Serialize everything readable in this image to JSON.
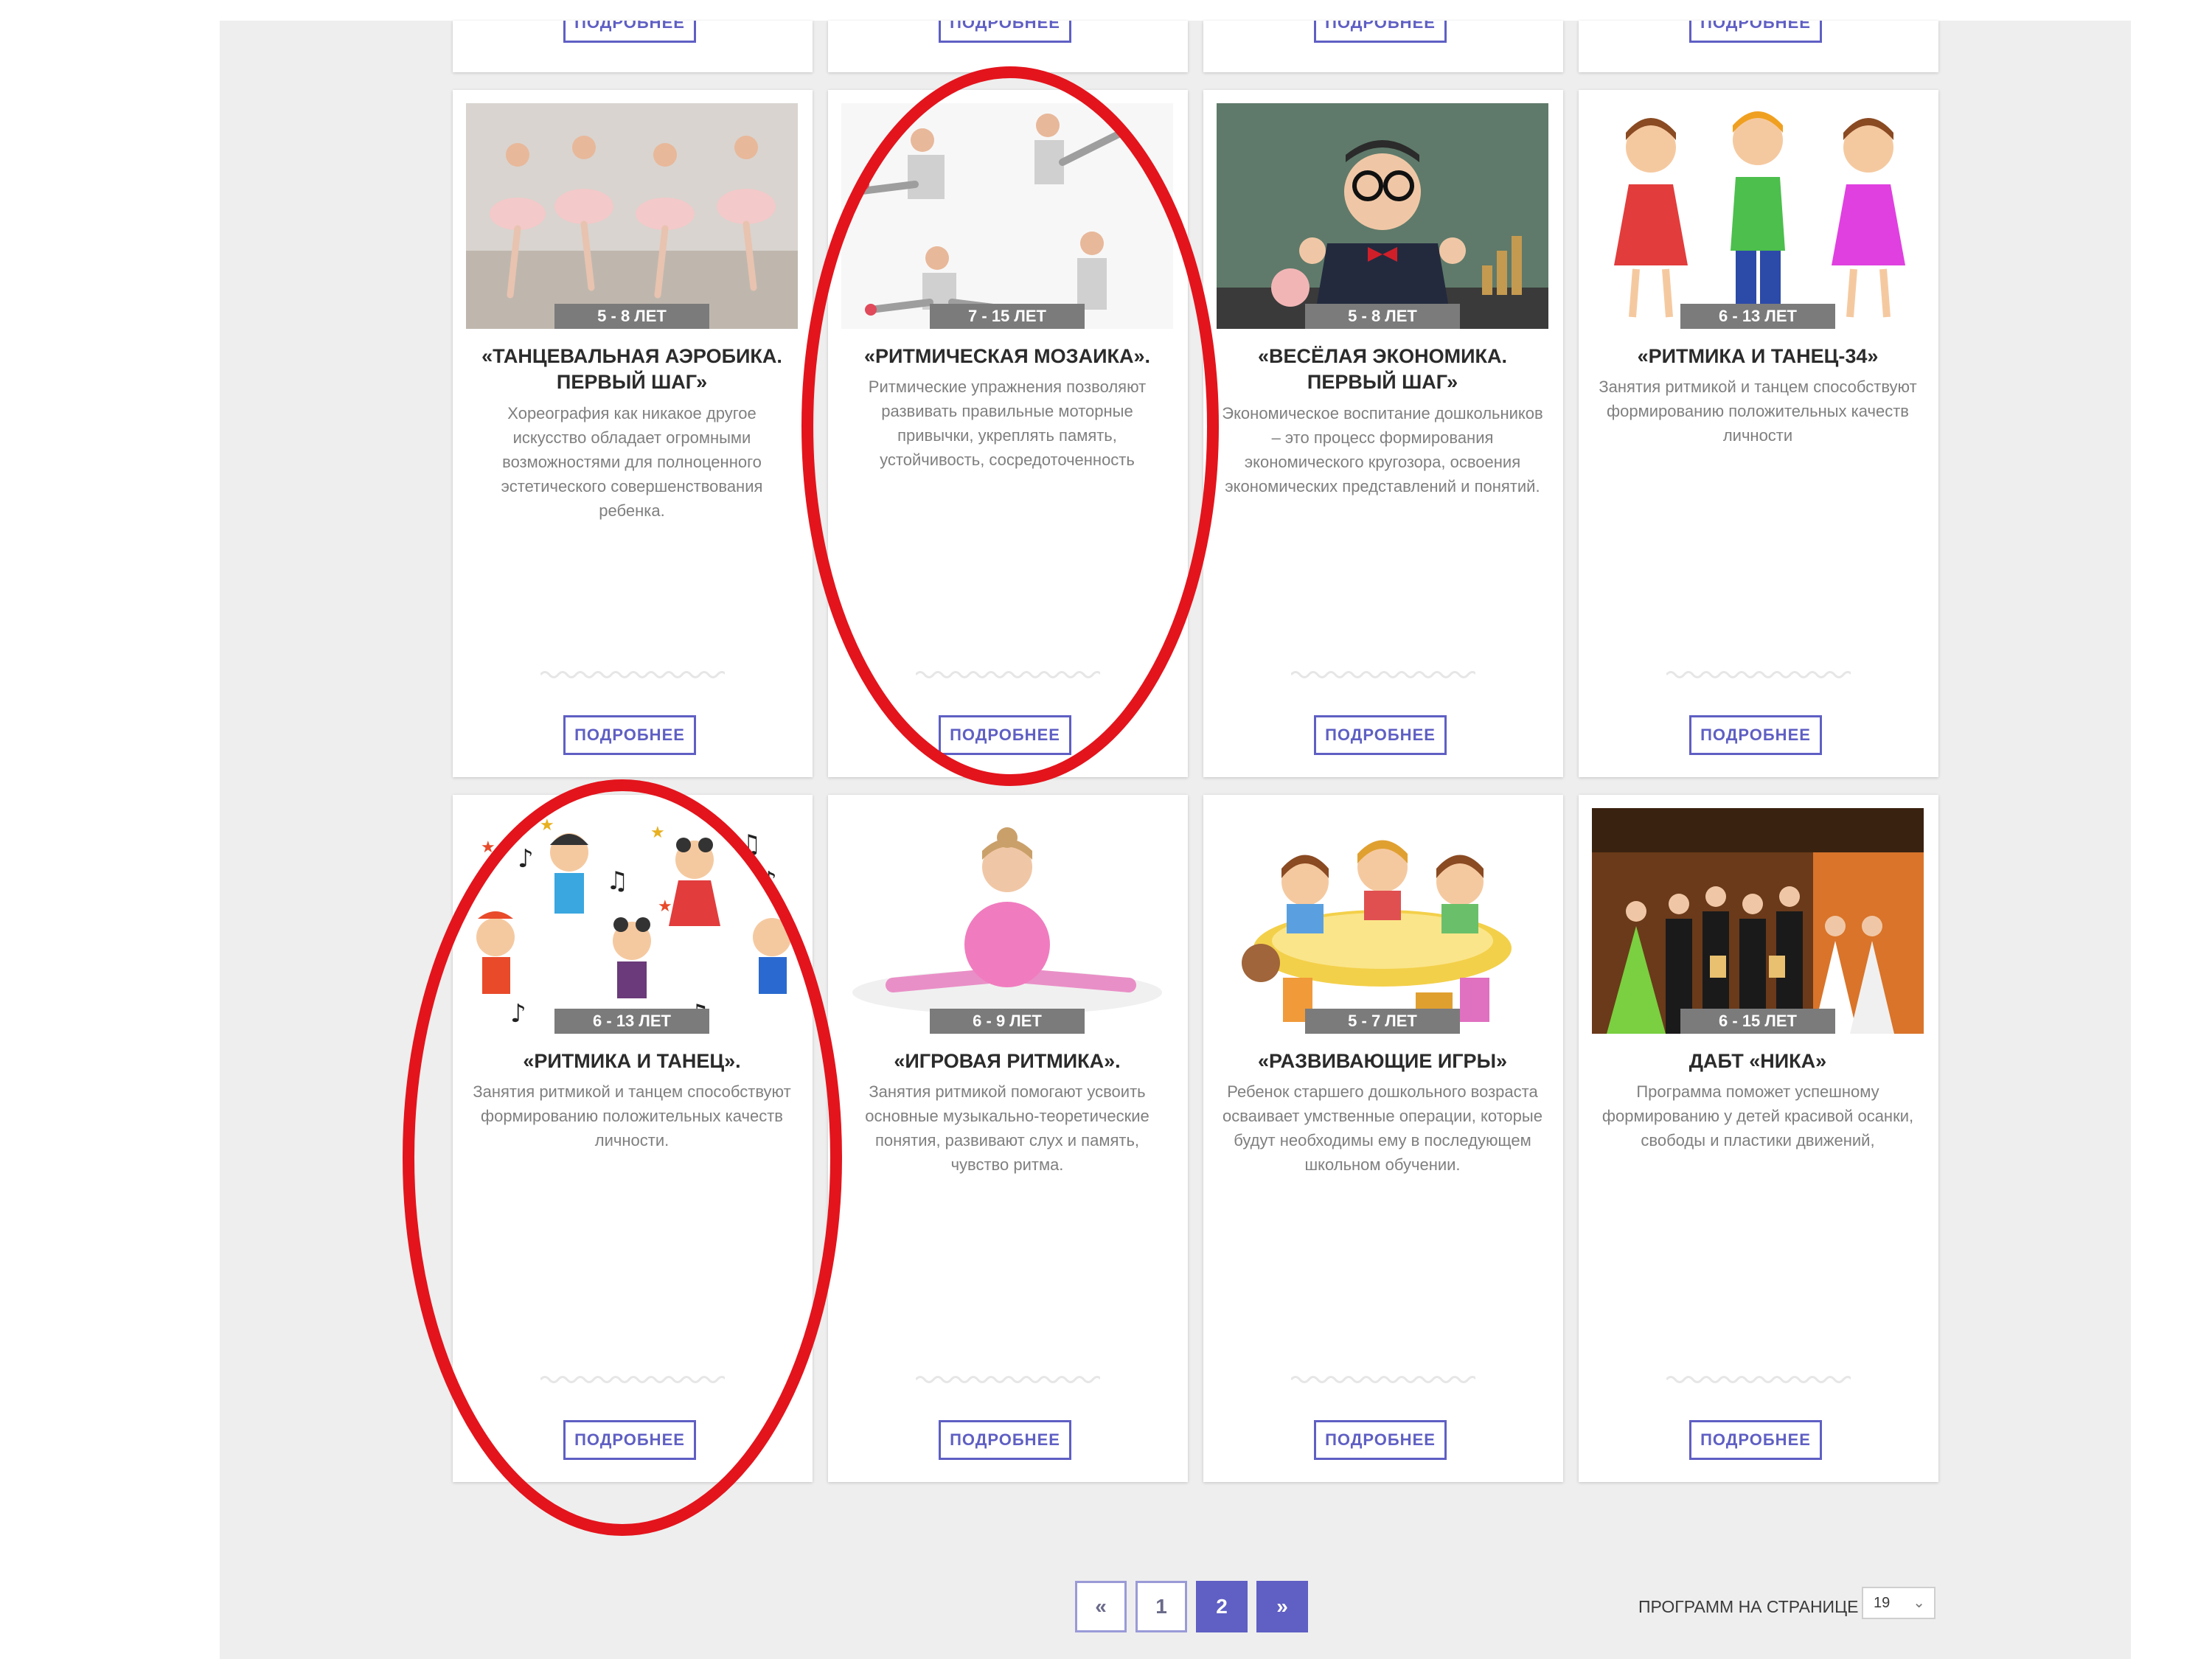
{
  "cards_top_partial": [
    {
      "button": "ПОДРОБНЕЕ"
    },
    {
      "button": "ПОДРОБНЕЕ"
    },
    {
      "button": "ПОДРОБНЕЕ"
    },
    {
      "button": "ПОДРОБНЕЕ"
    }
  ],
  "cards": [
    {
      "age": "5 - 8 ЛЕТ",
      "title": "«ТАНЦЕВАЛЬНАЯ АЭРОБИКА. ПЕРВЫЙ ШАГ»",
      "description": "Хореография как никакое другое искусство обладает огромными возможностями для полноценного эстетического совершенствования ребенка.",
      "button": "ПОДРОБНЕЕ"
    },
    {
      "age": "7 - 15 ЛЕТ",
      "title": "«РИТМИЧЕСКАЯ МОЗАИКА».",
      "description": "Ритмические упражнения позволяют развивать правильные моторные привычки, укреплять память, устойчивость, сосредоточенность",
      "button": "ПОДРОБНЕЕ"
    },
    {
      "age": "5 - 8 ЛЕТ",
      "title": "«ВЕСЁЛАЯ ЭКОНОМИКА. ПЕРВЫЙ ШАГ»",
      "description": "Экономическое воспитание дошкольников – это процесс формирования экономического кругозора, освоения экономических представлений и понятий.",
      "button": "ПОДРОБНЕЕ"
    },
    {
      "age": "6 - 13 ЛЕТ",
      "title": "«РИТМИКА И ТАНЕЦ-34»",
      "description": "Занятия ритмикой и танцем способствуют формированию положительных качеств личности",
      "button": "ПОДРОБНЕЕ"
    },
    {
      "age": "6 - 13 ЛЕТ",
      "title": "«РИТМИКА И ТАНЕЦ».",
      "description": "Занятия ритмикой и танцем способствуют формированию положительных качеств личности.",
      "button": "ПОДРОБНЕЕ"
    },
    {
      "age": "6 - 9 ЛЕТ",
      "title": "«ИГРОВАЯ РИТМИКА».",
      "description": "Занятия ритмикой помогают усвоить основные музыкально-теоретические понятия, развивают слух и память, чувство ритма.",
      "button": "ПОДРОБНЕЕ"
    },
    {
      "age": "5 - 7 ЛЕТ",
      "title": "«РАЗВИВАЮЩИЕ ИГРЫ»",
      "description": "Ребенок старшего дошкольного возраста осваивает умственные операции, которые будут необходимы ему в последующем школьном обучении.",
      "button": "ПОДРОБНЕЕ"
    },
    {
      "age": "6 - 15 ЛЕТ",
      "title": "ДАБТ «НИКА»",
      "description": "Программа поможет успешному формированию у детей красивой осанки, свободы и пластики движений,",
      "button": "ПОДРОБНЕЕ"
    }
  ],
  "pagination": {
    "prev": "«",
    "pages": [
      "1",
      "2"
    ],
    "current": "2",
    "next": "»",
    "per_page_label": "ПРОГРАММ НА СТРАНИЦЕ",
    "per_page_value": "19"
  },
  "colors": {
    "accent": "#5f5fc4",
    "badge": "#7b7b7b",
    "highlight": "#e3141c",
    "page_bg": "#eeeeee"
  }
}
